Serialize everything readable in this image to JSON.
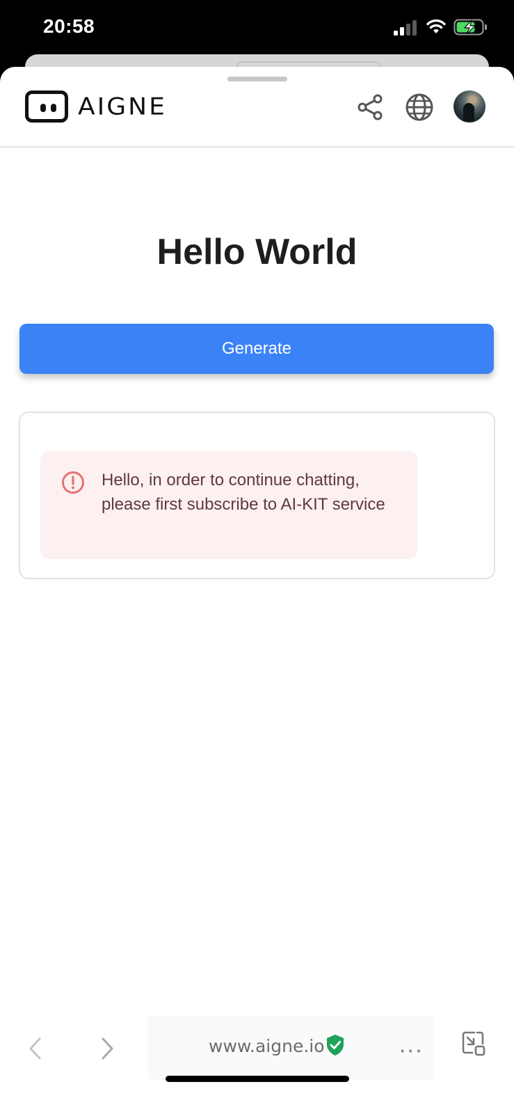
{
  "status_bar": {
    "time": "20:58"
  },
  "header": {
    "logo_text": "AIGNE"
  },
  "main": {
    "title": "Hello World",
    "generate_label": "Generate",
    "alert_message": "Hello, in order to continue chatting, please first subscribe to AI-KIT service"
  },
  "browser": {
    "url": "www.aigne.io",
    "more_label": "···"
  },
  "colors": {
    "primary": "#3b82f6",
    "alert_bg": "#fdf0f0",
    "alert_icon": "#e57373",
    "secure_shield": "#1ea25c"
  },
  "icons": [
    "share-icon",
    "globe-icon",
    "error-icon",
    "shield-check-icon",
    "chevron-left-icon",
    "chevron-right-icon",
    "minimize-window-icon"
  ]
}
